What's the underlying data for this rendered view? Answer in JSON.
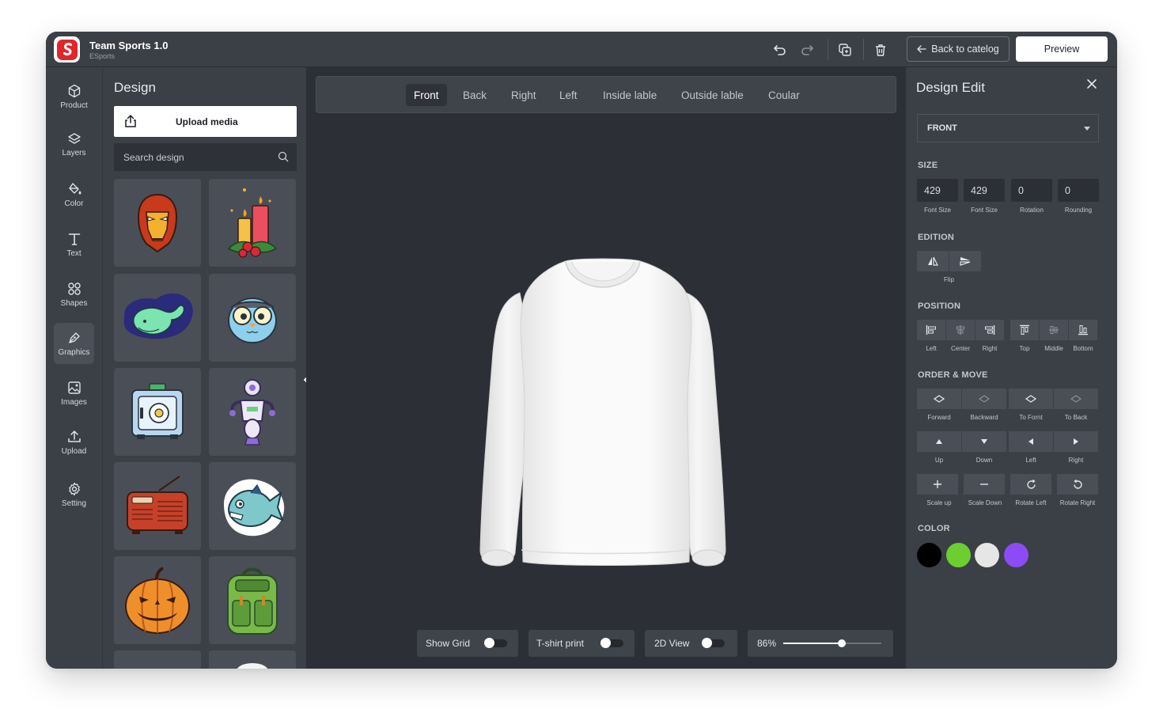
{
  "app": {
    "title": "Team Sports 1.0",
    "subtitle": "ESports"
  },
  "toolbar": {
    "back_label": "Back to catelog",
    "preview_label": "Preview"
  },
  "nav": [
    {
      "label": "Product",
      "icon": "cube-icon"
    },
    {
      "label": "Layers",
      "icon": "layers-icon"
    },
    {
      "label": "Color",
      "icon": "paint-bucket-icon"
    },
    {
      "label": "Text",
      "icon": "text-icon"
    },
    {
      "label": "Shapes",
      "icon": "shapes-icon"
    },
    {
      "label": "Graphics",
      "icon": "pen-icon",
      "active": true
    },
    {
      "label": "Images",
      "icon": "image-icon"
    },
    {
      "label": "Upload",
      "icon": "upload-icon"
    },
    {
      "label": "Setting",
      "icon": "gear-icon"
    }
  ],
  "design_panel": {
    "title": "Design",
    "upload_label": "Upload media",
    "search_placeholder": "Search design",
    "graphics": [
      "iron-man-mask",
      "christmas-candles",
      "whale",
      "owl",
      "safe",
      "robot",
      "radio",
      "piranha-fish",
      "jack-o-lantern",
      "backpack"
    ]
  },
  "view_tabs": [
    "Front",
    "Back",
    "Right",
    "Left",
    "Inside lable",
    "Outside lable",
    "Coular"
  ],
  "active_view": "Front",
  "bottom_controls": {
    "show_grid": {
      "label": "Show Grid",
      "on": false
    },
    "tshirt_print": {
      "label": "T-shirt print",
      "on": false
    },
    "view_2d": {
      "label": "2D View",
      "on": false
    },
    "zoom": {
      "label": "86%",
      "value": 0.6
    }
  },
  "design_edit": {
    "title": "Design Edit",
    "side_select": "FRONT",
    "size_label": "SIZE",
    "size_fields": [
      {
        "value": "429",
        "caption": "Font Size"
      },
      {
        "value": "429",
        "caption": "Font Size"
      },
      {
        "value": "0",
        "caption": "Rotation"
      },
      {
        "value": "0",
        "caption": "Rounding"
      }
    ],
    "edition_label": "EDITION",
    "flip_caption": "Flip",
    "position_label": "POSITION",
    "position_captions": [
      "Left",
      "Center",
      "Right",
      "Top",
      "Middle",
      "Bottom"
    ],
    "order_label": "ORDER & MOVE",
    "order_captions": [
      "Forward",
      "Backward",
      "To Fornt",
      "To Back"
    ],
    "move_captions": [
      "Up",
      "Down",
      "Left",
      "Right"
    ],
    "transform_captions": [
      "Scale up",
      "Scale Down",
      "Rotate Left",
      "Rotate Right"
    ],
    "color_label": "COLOR",
    "colors": [
      "#000000",
      "#6ccf2f",
      "#e6e6e6",
      "#8b4bf5"
    ]
  }
}
